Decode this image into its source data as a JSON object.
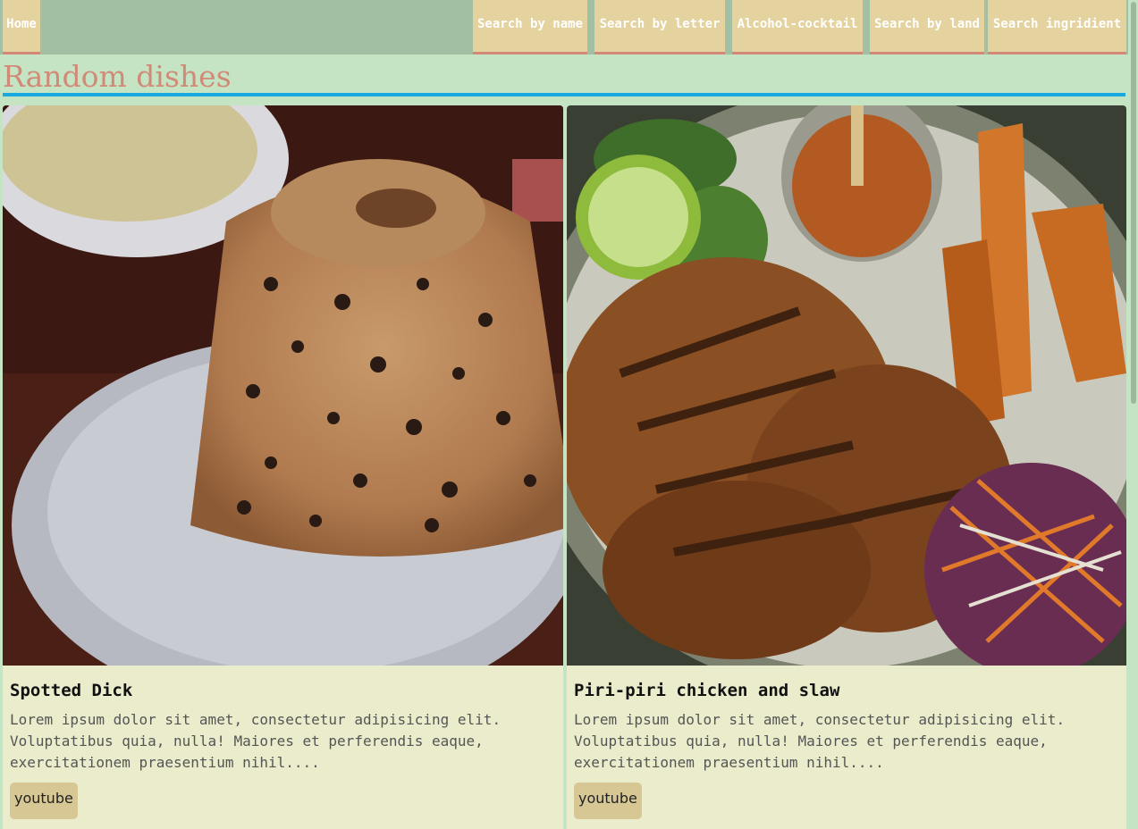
{
  "nav": {
    "home": "Home",
    "items": [
      {
        "label": "Search by name"
      },
      {
        "label": "Search by letter"
      },
      {
        "label": "Alcohol-cocktail"
      },
      {
        "label": "Search by land"
      },
      {
        "label": "Search ingridient"
      }
    ]
  },
  "heading": "Random dishes",
  "cards": [
    {
      "title": "Spotted Dick",
      "text": "Lorem ipsum dolor sit amet, consectetur adipisicing elit. Voluptatibus quia, nulla! Maiores et perferendis eaque, exercitationem praesentium nihil....",
      "button": "youtube"
    },
    {
      "title": "Piri-piri chicken and slaw",
      "text": "Lorem ipsum dolor sit amet, consectetur adipisicing elit. Voluptatibus quia, nulla! Maiores et perferendis eaque, exercitationem praesentium nihil....",
      "button": "youtube"
    }
  ],
  "colors": {
    "page_bg": "#c5e4c4",
    "nav_bg": "#a2bfa3",
    "nav_item_bg": "#e4d29f",
    "nav_item_border": "#d3897a",
    "heading": "#d08b78",
    "heading_rule": "#19a9e0",
    "card_bg": "#eaeccc",
    "button_bg": "#d7c795"
  }
}
